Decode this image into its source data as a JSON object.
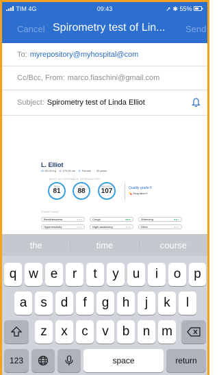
{
  "status_bar": {
    "carrier": "TIM 4G",
    "time": "09:43",
    "battery": "55%"
  },
  "nav": {
    "cancel_label": "Cancel",
    "title": "Spirometry test of Lin...",
    "send_label": "Send"
  },
  "compose": {
    "to_label": "To:",
    "to_value": "myrepository@myhospital@com",
    "cc_label": "Cc/Bcc, From:",
    "cc_value": "marco.fiaschini@gmail.com",
    "subject_label": "Subject:",
    "subject_value": "Spirometry test of Linda Elliot"
  },
  "attachment": {
    "name": "L. Elliot",
    "stats": [
      {
        "label": "W:",
        "value": "50.00 Kg"
      },
      {
        "label": "H:",
        "value": "175.00 cm"
      },
      {
        "label": "S:",
        "value": "Female"
      },
      {
        "label": "",
        "value": "30 years"
      }
    ],
    "section_spirometry": "BEST ACCEPTABLE SPIROMETRY",
    "gauges": [
      {
        "label": "FEV1",
        "value": "81"
      },
      {
        "label": "FEV",
        "value": "88"
      },
      {
        "label": "FEV1/FVC",
        "value": "107"
      }
    ],
    "quality": "Quality grade F",
    "drug": "Drug taken?",
    "section_symptoms": "SYMPTOMS",
    "symptoms": [
      {
        "name": "Breathlessness",
        "level": 0
      },
      {
        "name": "Cough",
        "level": 3
      },
      {
        "name": "Wheezing",
        "level": 2
      },
      {
        "name": "Hyperreactivity",
        "level": 0
      },
      {
        "name": "Night awakening",
        "level": 0
      },
      {
        "name": "Other",
        "level": 0
      }
    ]
  },
  "keyboard": {
    "suggestions": [
      "the",
      "time",
      "course"
    ],
    "row1": [
      "q",
      "w",
      "e",
      "r",
      "t",
      "y",
      "u",
      "i",
      "o",
      "p"
    ],
    "row2": [
      "a",
      "s",
      "d",
      "f",
      "g",
      "h",
      "j",
      "k",
      "l"
    ],
    "row3": [
      "z",
      "x",
      "c",
      "v",
      "b",
      "n",
      "m"
    ],
    "numbers_label": "123",
    "space_label": "space",
    "return_label": "return"
  },
  "colors": {
    "accent": "#2d6fce",
    "border": "#f4a21b",
    "keyboard_bg": "#d1d4da"
  }
}
